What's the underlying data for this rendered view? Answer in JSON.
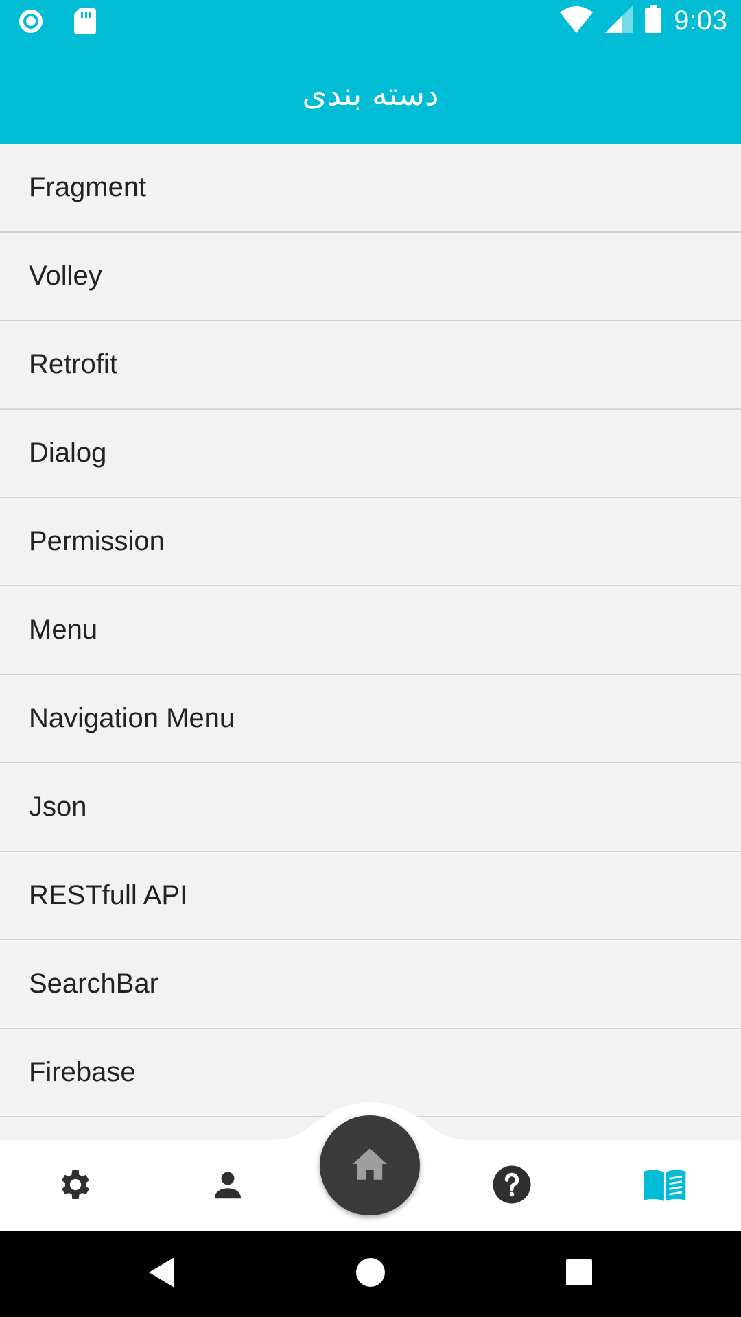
{
  "status_bar": {
    "time": "9:03",
    "icons": [
      "record-icon",
      "sd-card-icon",
      "wifi-icon",
      "signal-icon",
      "battery-icon"
    ]
  },
  "app_bar": {
    "title": "دسته بندی"
  },
  "categories": [
    {
      "label": "Fragment"
    },
    {
      "label": "Volley"
    },
    {
      "label": "Retrofit"
    },
    {
      "label": "Dialog"
    },
    {
      "label": "Permission"
    },
    {
      "label": "Menu"
    },
    {
      "label": "Navigation Menu"
    },
    {
      "label": "Json"
    },
    {
      "label": "RESTfull API"
    },
    {
      "label": "SearchBar"
    },
    {
      "label": "Firebase"
    }
  ],
  "bottom_nav": {
    "items": [
      "settings-icon",
      "person-icon",
      "home-icon",
      "help-icon",
      "book-icon"
    ],
    "active": "book-icon"
  },
  "colors": {
    "primary": "#00bcd4",
    "list_background": "#f2f2f2",
    "divider": "#d4d4d4",
    "fab": "#3a3a3a",
    "nav_icon": "#2f2f2f",
    "active_icon": "#00bcd4"
  }
}
